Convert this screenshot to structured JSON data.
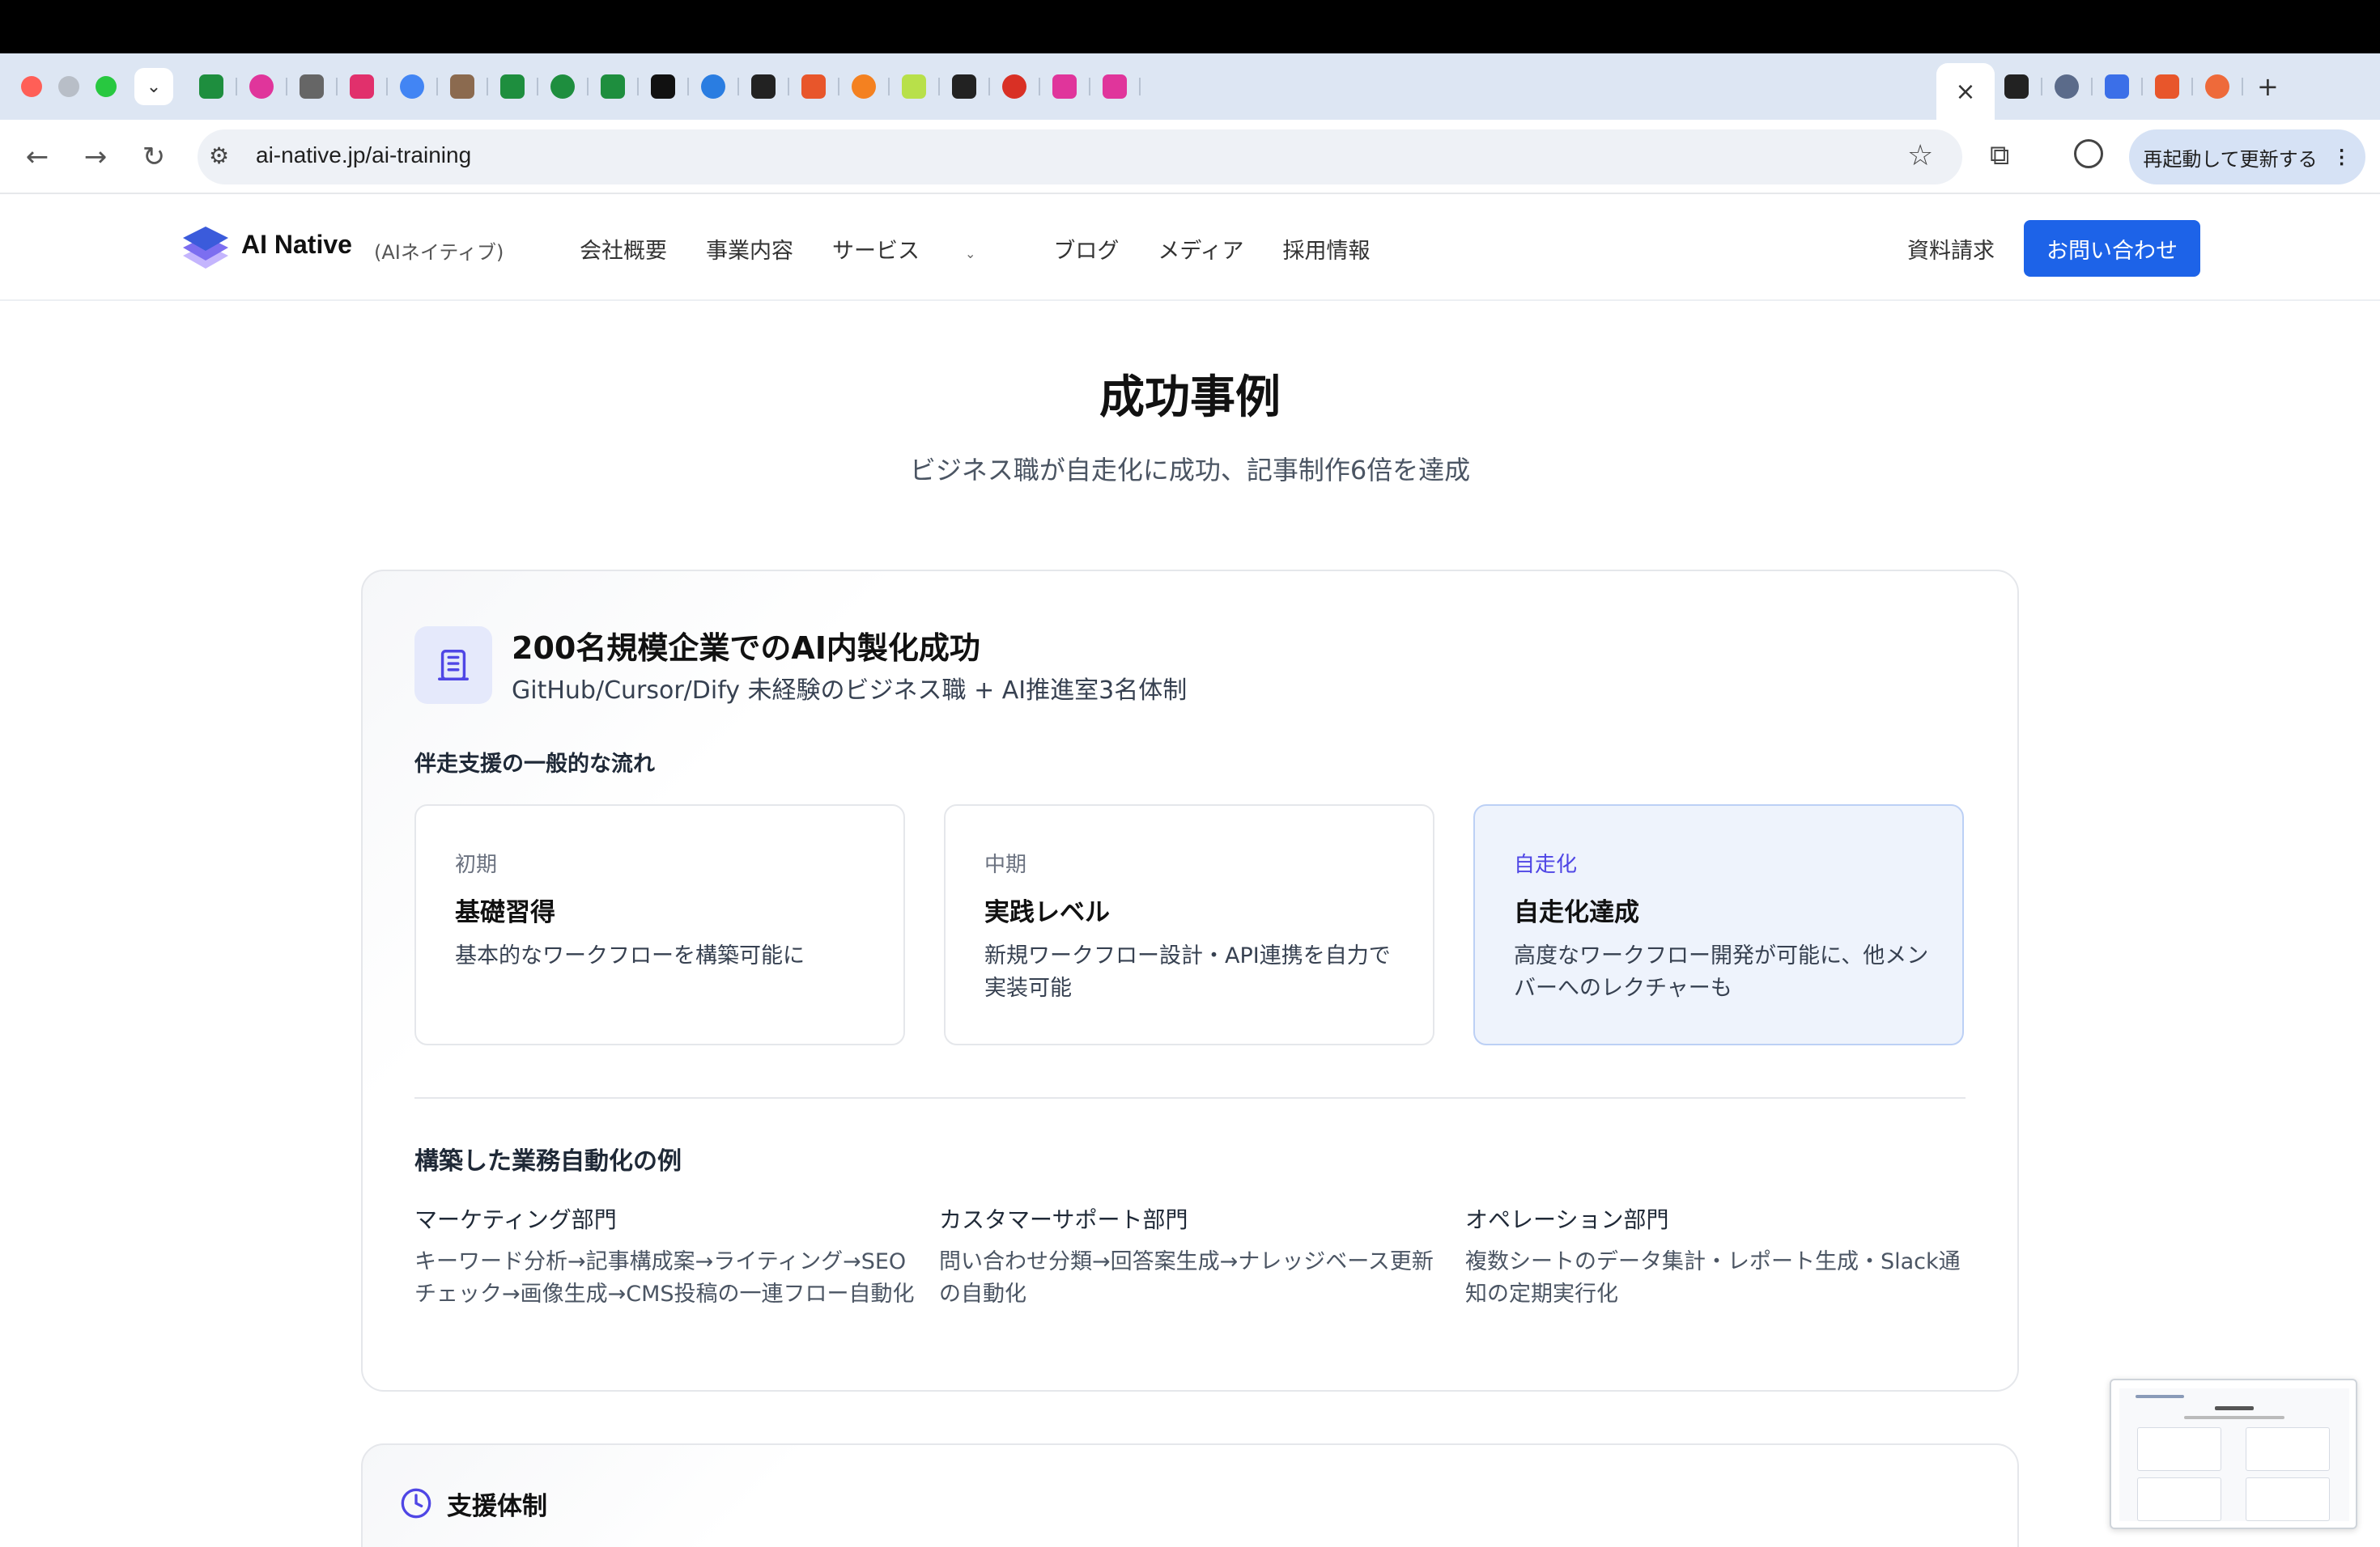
{
  "browser": {
    "url": "ai-native.jp/ai-training",
    "restart_label": "再起動して更新する",
    "restart_more": "⋮",
    "close_tab": "×",
    "new_tab": "+",
    "tab_menu": "⌄",
    "nav_back": "←",
    "nav_forward": "→",
    "nav_reload": "↻",
    "bookmark": "☆",
    "site_settings": "⚙",
    "extensions": "⧉",
    "favicon_colors": [
      "#1e8e3e",
      "#e0359b",
      "#666666",
      "#e1306c",
      "#4285f4",
      "#8b6a4f",
      "#1e8e3e",
      "#1e8e3e",
      "#1e8e3e",
      "#111111",
      "#2a7de1",
      "#222222",
      "#e8562b",
      "#f48120",
      "#b8e04a",
      "#222222",
      "#d93025",
      "#e0359b",
      "#e0359b",
      "#e0359b",
      "#222222",
      "#ee6a3a",
      "#1a56db",
      "#e8562b",
      "#2bbf3b",
      "#d93025",
      "#111111",
      "#e0359b",
      "#3b6fe8",
      "#3b6fe8"
    ],
    "favicon_colors_2": [
      "#222222",
      "#5b6b8a",
      "#3b6fe8",
      "#e8562b",
      "#ee6a3a"
    ]
  },
  "header": {
    "brand": "AI Native",
    "brand_sub": "(AIネイティブ)",
    "menu": [
      "会社概要",
      "事業内容",
      "サービス",
      "ブログ",
      "メディア",
      "採用情報"
    ],
    "menu_caret": "⌄",
    "docs": "資料請求",
    "contact": "お問い合わせ",
    "logo_colors": [
      "#3b5bdb",
      "#7c6ef0",
      "#c4b5fd"
    ]
  },
  "main": {
    "title": "成功事例",
    "subtitle": "ビジネス職が自走化に成功、記事制作6倍を達成"
  },
  "case": {
    "title": "200名規模企業でのAI内製化成功",
    "description": "GitHub/Cursor/Dify 未経験のビジネス職 + AI推進室3名体制",
    "flow_heading": "伴走支援の一般的な流れ",
    "phases": [
      {
        "label": "初期",
        "name": "基礎習得",
        "desc": "基本的なワークフローを構築可能に"
      },
      {
        "label": "中期",
        "name": "実践レベル",
        "desc": "新規ワークフロー設計・API連携を自力で実装可能"
      },
      {
        "label": "自走化",
        "name": "自走化達成",
        "desc": "高度なワークフロー開発が可能に、他メンバーへのレクチャーも"
      }
    ],
    "automation_heading": "構築した業務自動化の例",
    "departments": [
      {
        "name": "マーケティング部門",
        "desc": "キーワード分析→記事構成案→ライティング→SEOチェック→画像生成→CMS投稿の一連フロー自動化"
      },
      {
        "name": "カスタマーサポート部門",
        "desc": "問い合わせ分類→回答案生成→ナレッジベース更新の自動化"
      },
      {
        "name": "オペレーション部門",
        "desc": "複数シートのデータ集計・レポート生成・Slack通知の定期実行化"
      }
    ]
  },
  "support": {
    "title": "支援体制"
  },
  "accent": "#1d63e8"
}
